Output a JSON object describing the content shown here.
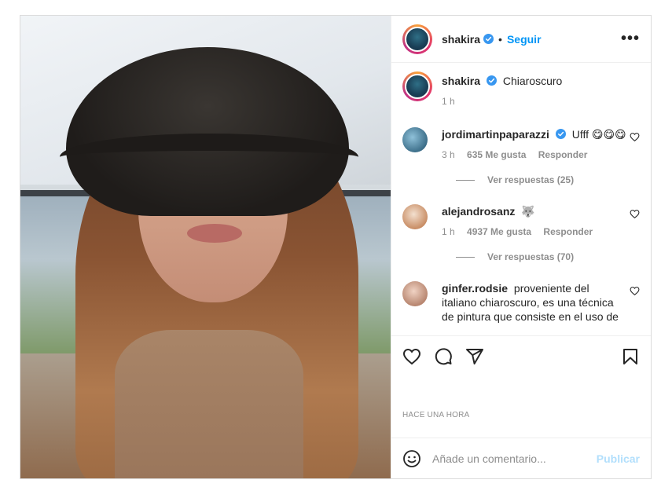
{
  "post": {
    "author": "shakira",
    "follow_label": "Seguir",
    "separator": "•",
    "more_label": "•••",
    "caption": {
      "username": "shakira",
      "text": "Chiaroscuro",
      "time": "1 h"
    },
    "comments": [
      {
        "username": "jordimartinpaparazzi",
        "verified": true,
        "text": "Ufff 😋😋😋",
        "time": "3 h",
        "likes": "635 Me gusta",
        "reply_label": "Responder",
        "replies": "Ver respuestas (25)"
      },
      {
        "username": "alejandrosanz",
        "verified": false,
        "text": "🐺",
        "time": "1 h",
        "likes": "4937 Me gusta",
        "reply_label": "Responder",
        "replies": "Ver respuestas (70)"
      },
      {
        "username": "ginfer.rodsie",
        "verified": false,
        "text": "proveniente del italiano chiaroscuro, es una técnica de pintura que consiste en el uso de",
        "time": "",
        "likes": "",
        "reply_label": "",
        "replies": ""
      }
    ],
    "time_ago": "HACE UNA HORA",
    "composer": {
      "placeholder": "Añade un comentario...",
      "publish_label": "Publicar"
    },
    "icons": {
      "like": "heart-icon",
      "comment": "comment-icon",
      "share": "share-icon",
      "save": "bookmark-icon",
      "emoji": "emoji-icon",
      "verified": "verified-badge-icon",
      "more": "more-options-icon"
    },
    "colors": {
      "link_blue": "#0095f6",
      "publish_disabled": "#b2dffc",
      "muted": "#8e8e8e",
      "verified": "#3897f0"
    }
  }
}
